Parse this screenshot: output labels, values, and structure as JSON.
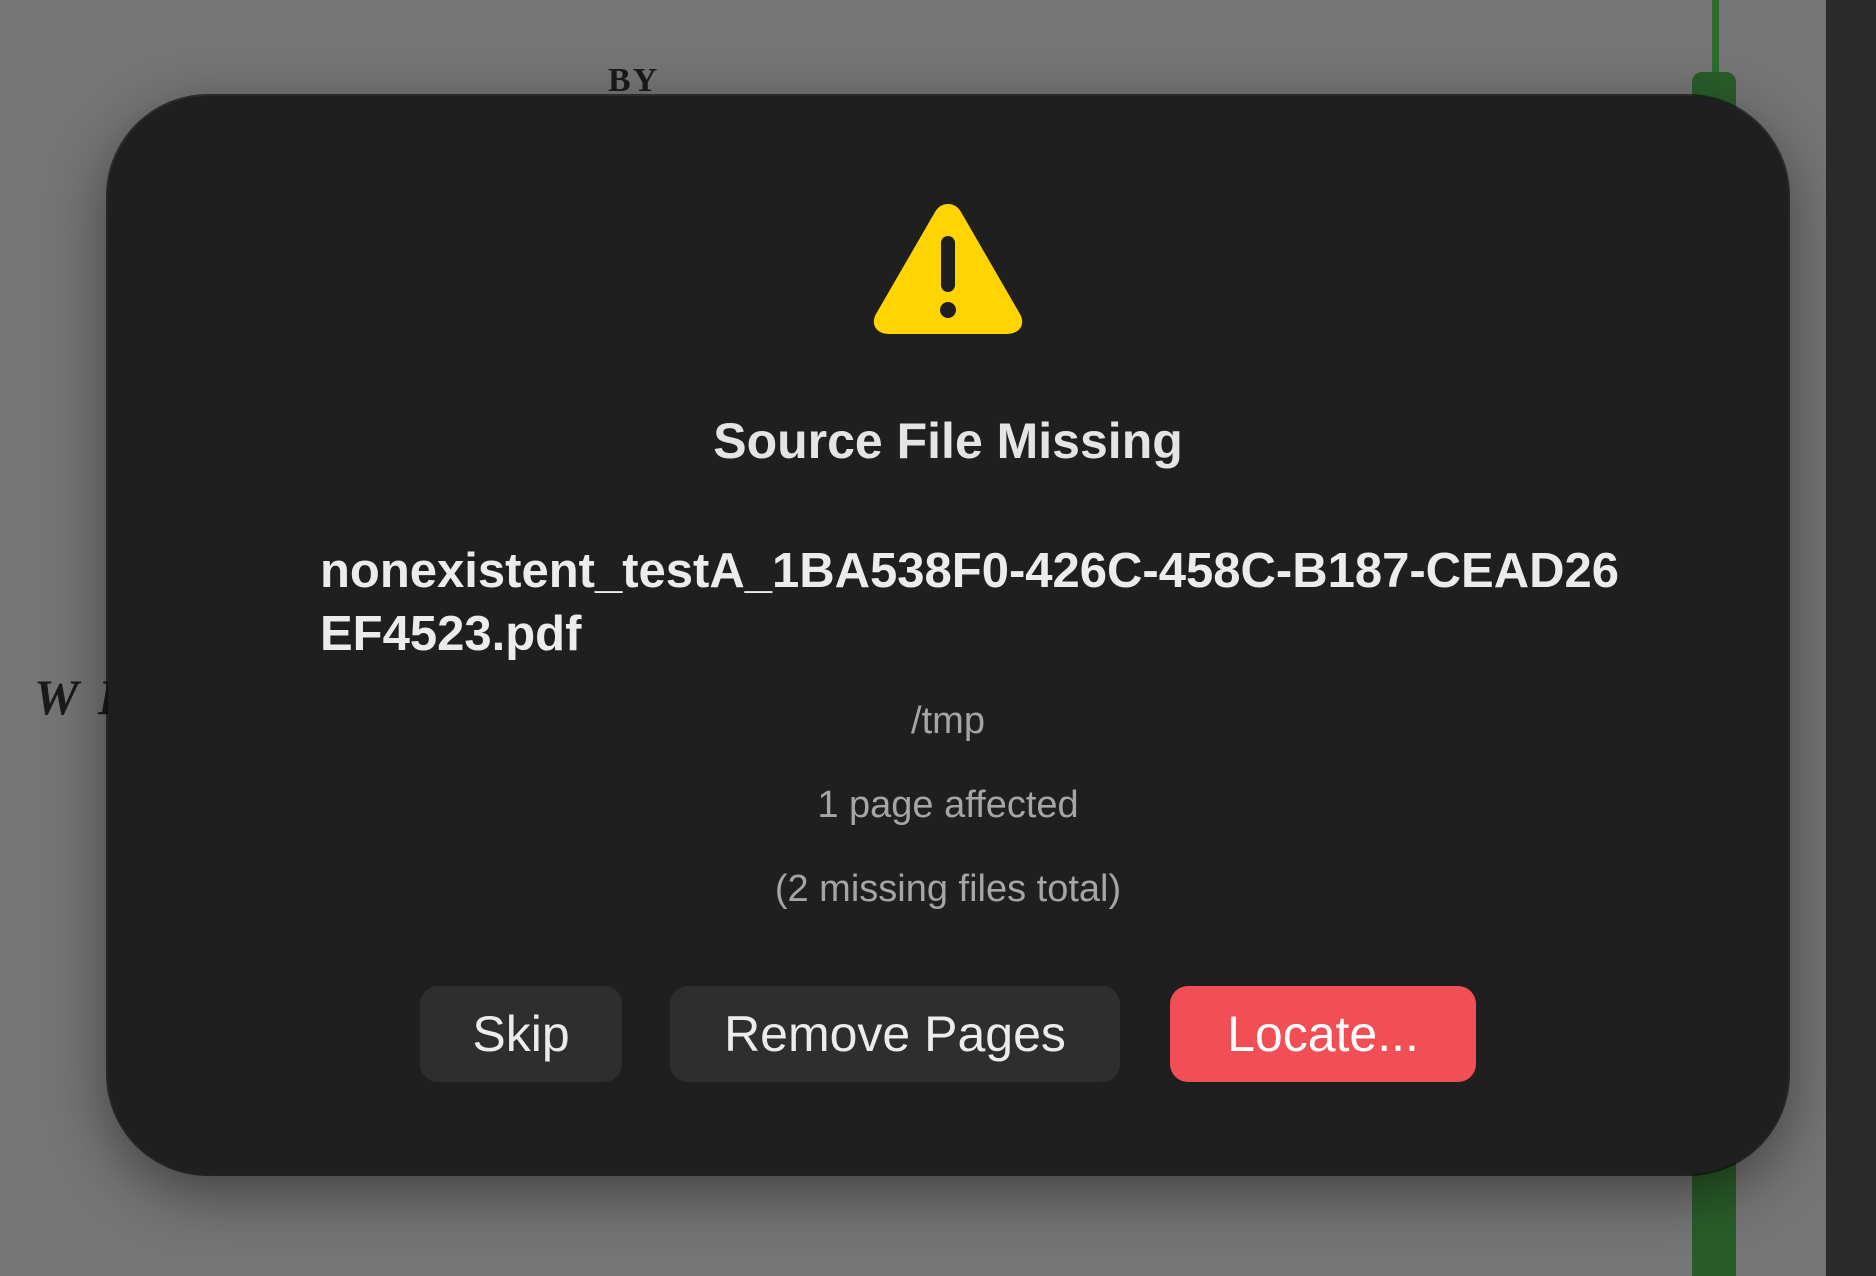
{
  "background": {
    "doc_text_top": "BY",
    "doc_text_left": "W I"
  },
  "dialog": {
    "icon": "warning-triangle-icon",
    "title": "Source File Missing",
    "filename": "nonexistent_testA_1BA538F0-426C-458C-B187-CEAD26EF4523.pdf",
    "path": "/tmp",
    "pages_affected": "1 page affected",
    "total_missing": "(2 missing files total)"
  },
  "buttons": {
    "skip": "Skip",
    "remove_pages": "Remove Pages",
    "locate": "Locate..."
  },
  "colors": {
    "dialog_background": "#1f1f1f",
    "warning_yellow": "#ffd400",
    "primary_button": "#f14f55",
    "secondary_button": "#2e2e2e"
  }
}
